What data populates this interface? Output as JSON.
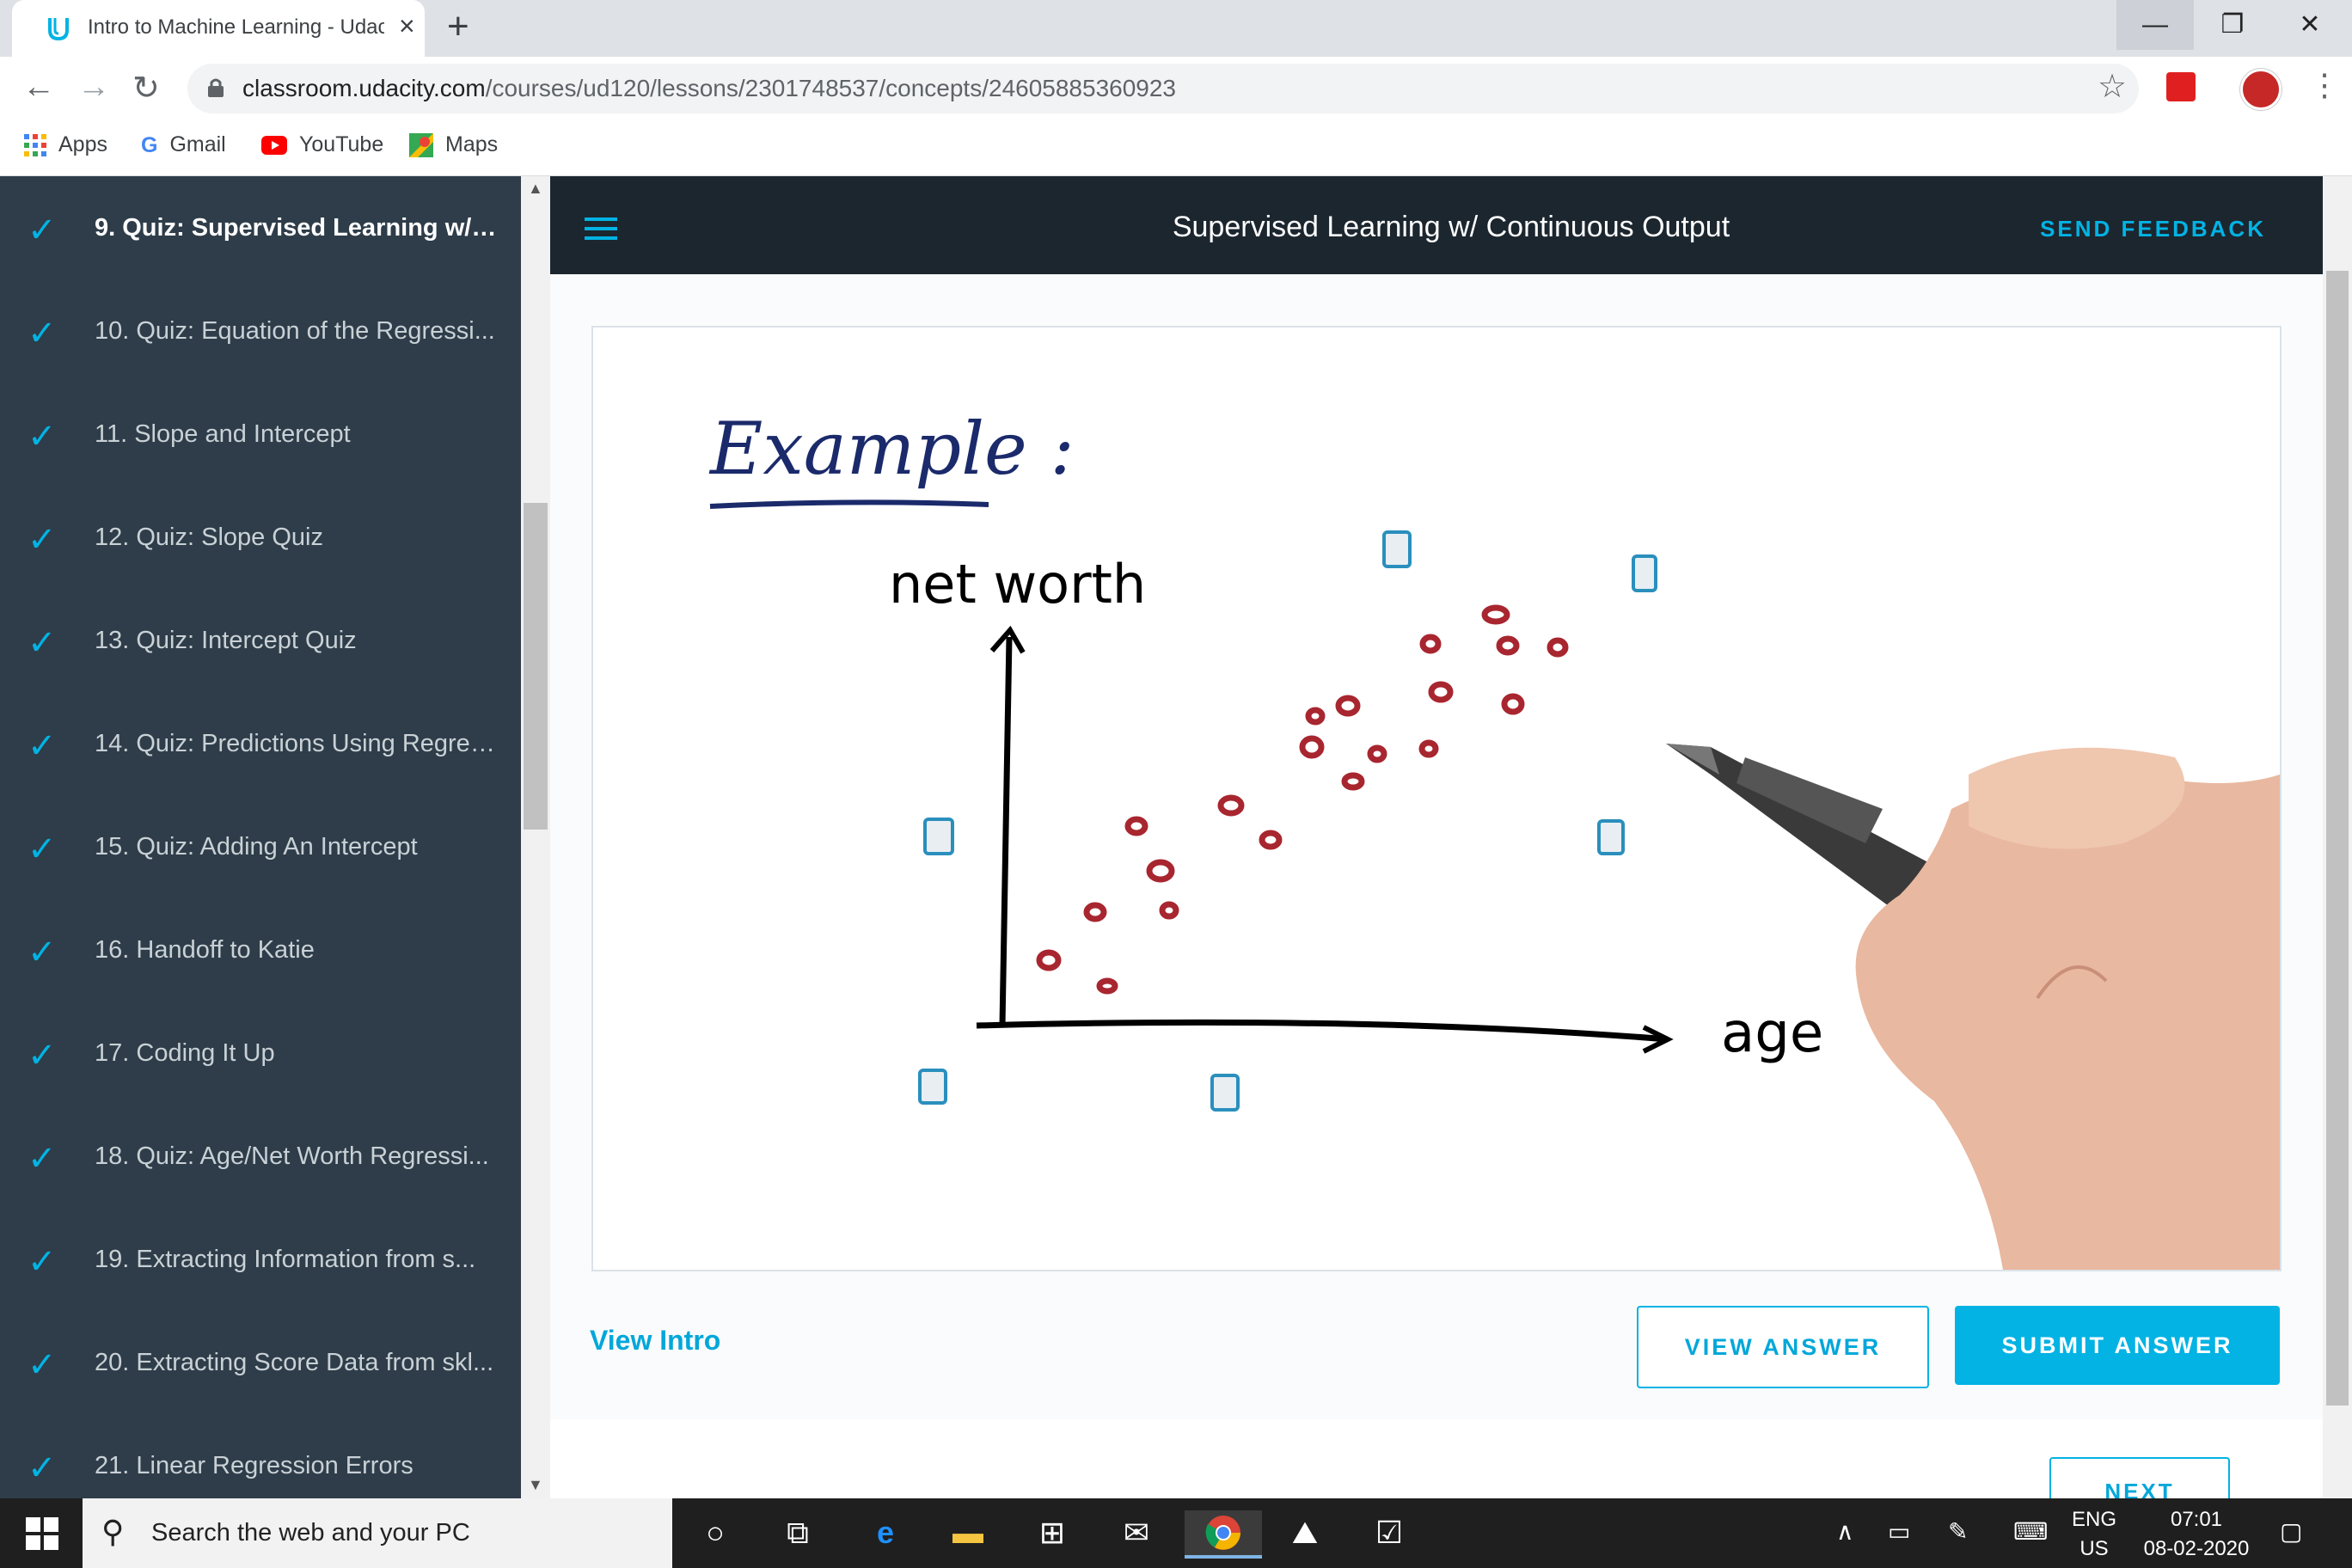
{
  "browser": {
    "tab_title": "Intro to Machine Learning - Udac",
    "tab_close": "×",
    "new_tab": "+",
    "url_host": "classroom.udacity.com",
    "url_path": "/courses/ud120/lessons/2301748537/concepts/24605885360923",
    "bookmarks": [
      "Apps",
      "Gmail",
      "YouTube",
      "Maps"
    ]
  },
  "sidebar": {
    "items": [
      {
        "label": "9. Quiz: Supervised Learning w/ ...",
        "active": true
      },
      {
        "label": "10. Quiz: Equation of the Regressi..."
      },
      {
        "label": "11. Slope and Intercept"
      },
      {
        "label": "12. Quiz: Slope Quiz"
      },
      {
        "label": "13. Quiz: Intercept Quiz"
      },
      {
        "label": "14. Quiz: Predictions Using Regres..."
      },
      {
        "label": "15. Quiz: Adding An Intercept"
      },
      {
        "label": "16. Handoff to Katie"
      },
      {
        "label": "17. Coding It Up"
      },
      {
        "label": "18. Quiz: Age/Net Worth Regressi..."
      },
      {
        "label": "19. Extracting Information from s..."
      },
      {
        "label": "20. Extracting Score Data from skl..."
      },
      {
        "label": "21. Linear Regression Errors"
      }
    ]
  },
  "header": {
    "title": "Supervised Learning w/ Continuous Output",
    "feedback": "SEND FEEDBACK"
  },
  "video": {
    "heading": "Example :",
    "y_label": "net worth",
    "x_label": "age"
  },
  "actions": {
    "view_intro": "View Intro",
    "view_answer": "VIEW ANSWER",
    "submit_answer": "SUBMIT ANSWER",
    "next": "NEXT"
  },
  "taskbar": {
    "search_placeholder": "Search the web and your PC",
    "lang_top": "ENG",
    "lang_bottom": "US",
    "time": "07:01",
    "date": "08-02-2020"
  },
  "colors": {
    "accent": "#02b3e4",
    "sidebar_bg": "#2e3d49",
    "header_bg": "#1c262f",
    "point_color": "#a8262f"
  }
}
